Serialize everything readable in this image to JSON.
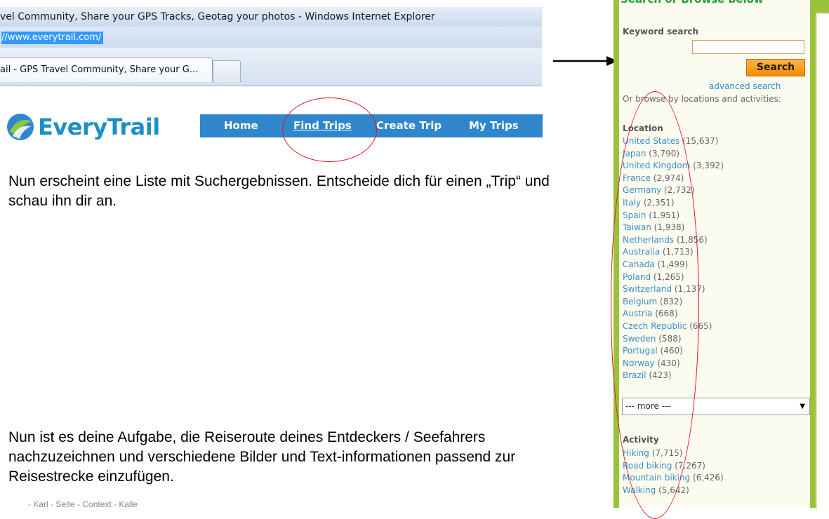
{
  "browser": {
    "window_title": "vel Community, Share your GPS Tracks, Geotag your photos - Windows Internet Explorer",
    "address": "//www.everytrail.com/",
    "tab_label": "ail - GPS Travel Community, Share your G..."
  },
  "site": {
    "logo_text": "EveryTrail",
    "nav": {
      "home": "Home",
      "find_trips": "Find Trips",
      "create_trip": "Create Trip",
      "my_trips": "My Trips"
    }
  },
  "document": {
    "paragraph1": "Nun erscheint eine Liste mit Suchergebnissen. Entscheide dich für einen „Trip“ und schau ihn dir an.",
    "paragraph2": "Nun ist es deine Aufgabe, die Reiseroute deines Entdeckers / Seefahrers nachzuzeichnen und verschiedene Bilder und Text-informationen passend zur Reisestrecke einzufügen.",
    "footer_fragment": "- Karl - Seite - Context - Kalle"
  },
  "panel": {
    "header": "Search or Browse below",
    "keyword_label": "Keyword search",
    "keyword_value": "",
    "search_button": "Search",
    "advanced_search": "advanced search",
    "browse_text": "Or browse by locations and activities:",
    "location_heading": "Location",
    "locations": [
      {
        "name": "United States",
        "count": "(15,637)"
      },
      {
        "name": "Japan",
        "count": "(3,790)"
      },
      {
        "name": "United Kingdom",
        "count": "(3,392)"
      },
      {
        "name": "France",
        "count": "(2,974)"
      },
      {
        "name": "Germany",
        "count": "(2,732)"
      },
      {
        "name": "Italy",
        "count": "(2,351)"
      },
      {
        "name": "Spain",
        "count": "(1,951)"
      },
      {
        "name": "Taiwan",
        "count": "(1,938)"
      },
      {
        "name": "Netherlands",
        "count": "(1,856)"
      },
      {
        "name": "Australia",
        "count": "(1,713)"
      },
      {
        "name": "Canada",
        "count": "(1,499)"
      },
      {
        "name": "Poland",
        "count": "(1,265)"
      },
      {
        "name": "Switzerland",
        "count": "(1,137)"
      },
      {
        "name": "Belgium",
        "count": "(832)"
      },
      {
        "name": "Austria",
        "count": "(668)"
      },
      {
        "name": "Czech Republic",
        "count": "(665)"
      },
      {
        "name": "Sweden",
        "count": "(588)"
      },
      {
        "name": "Portugal",
        "count": "(460)"
      },
      {
        "name": "Norway",
        "count": "(430)"
      },
      {
        "name": "Brazil",
        "count": "(423)"
      }
    ],
    "more_select": "--- more ---",
    "activity_heading": "Activity",
    "activities": [
      {
        "name": "Hiking",
        "count": "(7,715)"
      },
      {
        "name": "Road biking",
        "count": "(7,267)"
      },
      {
        "name": "Mountain biking",
        "count": "(6,426)"
      },
      {
        "name": "Walking",
        "count": "(5,642)"
      }
    ]
  },
  "annotation_color": "#e0151b",
  "accent_green": "#9ac23a",
  "nav_blue": "#2f86cc"
}
